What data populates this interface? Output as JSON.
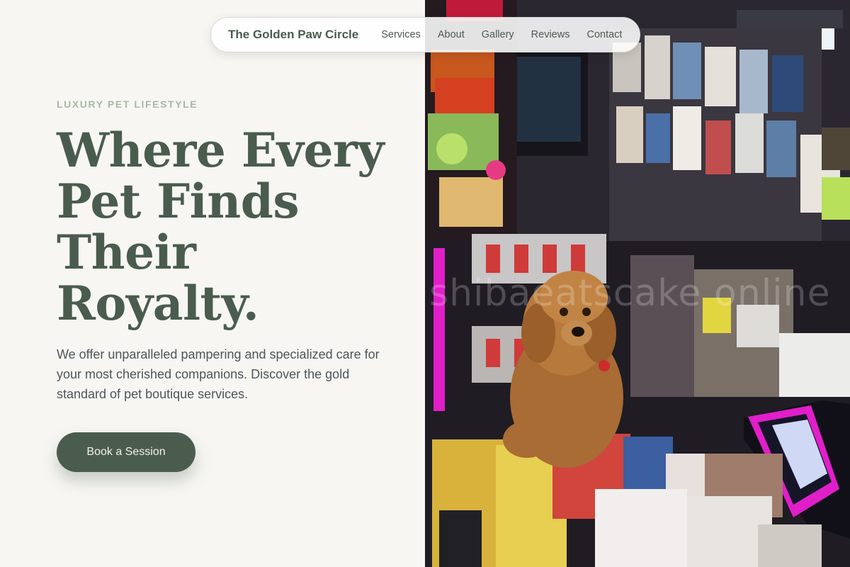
{
  "nav": {
    "brand": "The Golden Paw Circle",
    "links": [
      "Services",
      "About",
      "Gallery",
      "Reviews",
      "Contact"
    ]
  },
  "hero": {
    "eyebrow": "LUXURY PET LIFESTYLE",
    "headline_lines": [
      "Where Every",
      "Pet Finds",
      "Their",
      "Royalty."
    ],
    "description": "We offer unparalleled pampering and specialized care for your most cherished companions. Discover the gold standard of pet boutique services.",
    "cta_label": "Book a Session"
  },
  "photo": {
    "subject": "poodle-in-newsstand",
    "watermark": "shibaeatscake online"
  },
  "colors": {
    "background": "#f7f6f3",
    "primary": "#4a5c4e",
    "eyebrow": "#a9b8a6",
    "body_text": "#4e555a",
    "accent_magenta": "#e01fc9"
  }
}
